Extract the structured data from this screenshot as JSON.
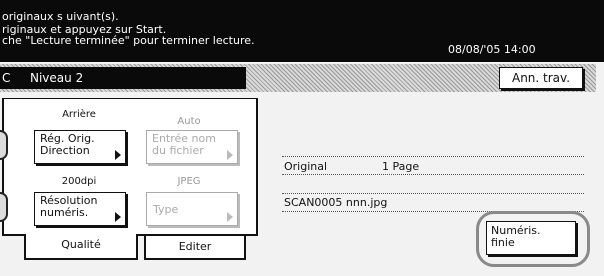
{
  "message": {
    "line1": "originaux s uivant(s).",
    "line2": "riginaux et appuyez sur Start.",
    "line3": "che \"Lecture terminée\" pour terminer lecture.",
    "datetime": "08/08/'05 14:00"
  },
  "level_bar": {
    "prefix": "C",
    "level": "Niveau 2",
    "ann_button": "Ann. trav."
  },
  "settings": {
    "arriere_label": "Arrière",
    "reg_button_line1": "Rég. Orig.",
    "reg_button_line2": "Direction",
    "auto_label": "Auto",
    "entree_line1": "Entrée nom",
    "entree_line2": "du fichier",
    "resolution_value": "200dpi",
    "resolution_line1": "Résolution",
    "resolution_line2": "numéris.",
    "format_value": "JPEG",
    "type_button": "Type"
  },
  "tabs": {
    "qualite": "Qualité",
    "editer": "Editer"
  },
  "info": {
    "original_label": "Original",
    "pages": "1 Page",
    "filename": "SCAN0005 nnn.jpg"
  },
  "finish_button": {
    "line1": "Numéris.",
    "line2": "finie"
  }
}
